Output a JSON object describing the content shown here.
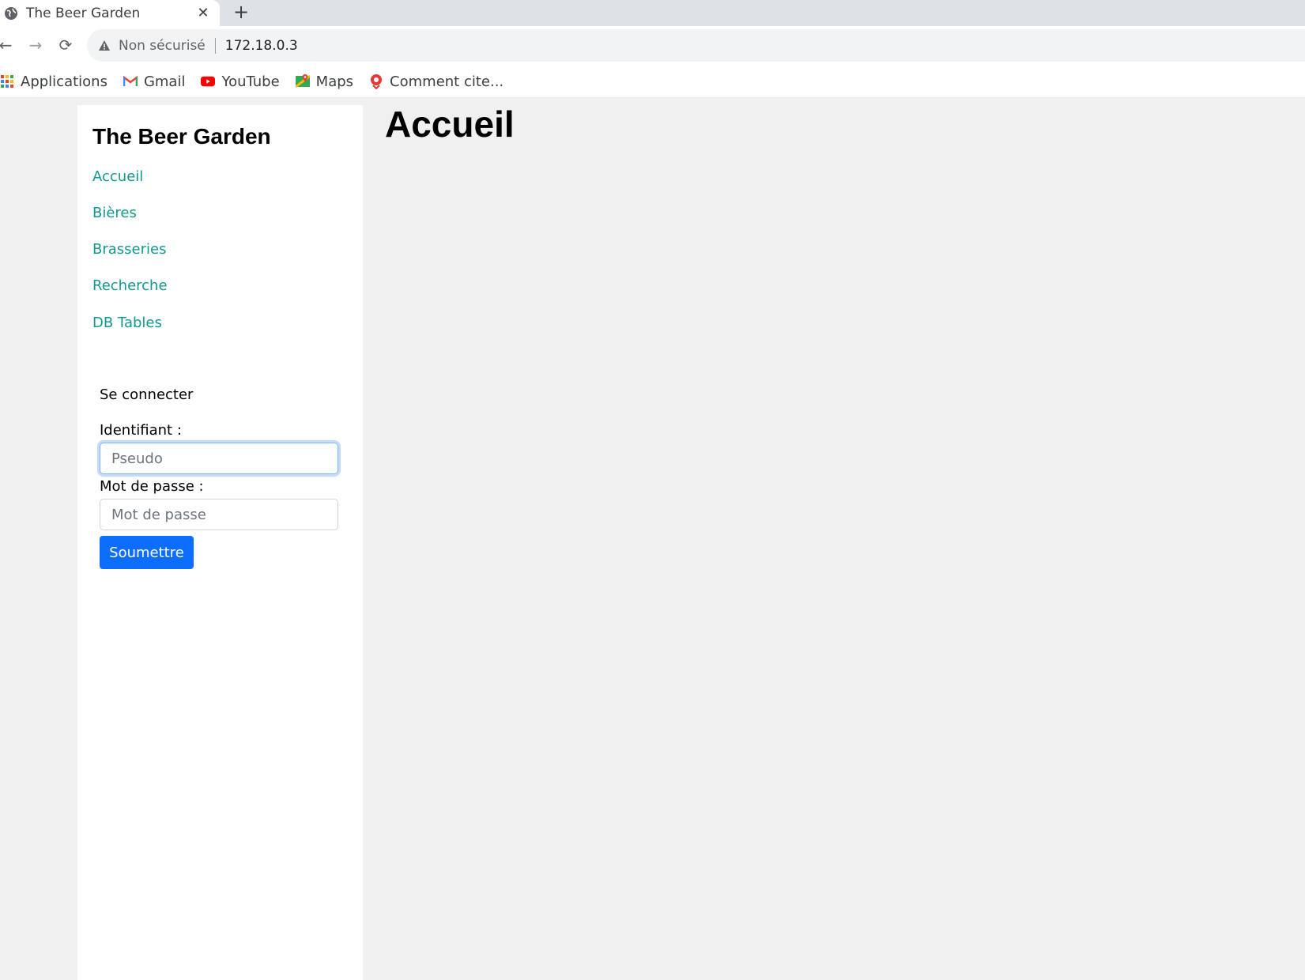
{
  "browser": {
    "tab": {
      "title": "The Beer Garden",
      "close_glyph": "✕"
    },
    "new_tab_glyph": "+",
    "nav": {
      "back_glyph": "←",
      "forward_glyph": "→",
      "reload_glyph": "⟳"
    },
    "omnibox": {
      "security_label": "Non sécurisé",
      "url": "172.18.0.3"
    },
    "bookmarks": [
      {
        "label": "Applications",
        "icon": "apps-grid-icon"
      },
      {
        "label": "Gmail",
        "icon": "gmail-icon"
      },
      {
        "label": "YouTube",
        "icon": "youtube-icon"
      },
      {
        "label": "Maps",
        "icon": "maps-icon"
      },
      {
        "label": "Comment cite...",
        "icon": "bookmark-favicon-icon"
      }
    ]
  },
  "sidebar": {
    "site_title": "The Beer Garden",
    "links": [
      {
        "label": "Accueil"
      },
      {
        "label": "Bières"
      },
      {
        "label": "Brasseries"
      },
      {
        "label": "Recherche"
      },
      {
        "label": "DB Tables"
      }
    ],
    "login": {
      "title": "Se connecter",
      "username_label": "Identifiant :",
      "username_placeholder": "Pseudo",
      "password_label": "Mot de passe :",
      "password_placeholder": "Mot de passe",
      "submit_label": "Soumettre"
    }
  },
  "main": {
    "heading": "Accueil"
  },
  "colors": {
    "link": "#11998e",
    "primary_button": "#0d6efd",
    "page_background": "#f0f0f1"
  }
}
